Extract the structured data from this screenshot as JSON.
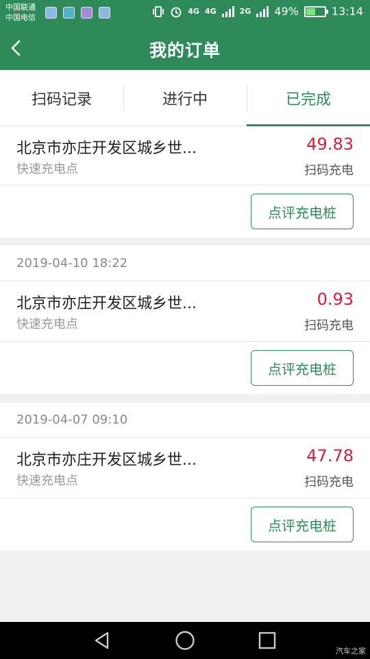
{
  "status_bar": {
    "carrier_1": "中国联通",
    "carrier_2": "中国电信",
    "network_1": "4G",
    "network_2": "4G",
    "network_3": "2G",
    "battery": "49%",
    "battery_level": 0.49,
    "time": "13:14"
  },
  "header": {
    "title": "我的订单"
  },
  "tabs": [
    {
      "label": "扫码记录",
      "active": false
    },
    {
      "label": "进行中",
      "active": false
    },
    {
      "label": "已完成",
      "active": true
    }
  ],
  "orders": [
    {
      "date": "",
      "station": "北京市亦庄开发区城乡世...",
      "type": "快速充电点",
      "amount": "49.83",
      "mode": "扫码充电",
      "action": "点评充电桩"
    },
    {
      "date": "2019-04-10 18:22",
      "station": "北京市亦庄开发区城乡世...",
      "type": "快速充电点",
      "amount": "0.93",
      "mode": "扫码充电",
      "action": "点评充电桩"
    },
    {
      "date": "2019-04-07 09:10",
      "station": "北京市亦庄开发区城乡世...",
      "type": "快速充电点",
      "amount": "47.78",
      "mode": "扫码充电",
      "action": "点评充电桩"
    }
  ],
  "watermark": "汽车之家",
  "colors": {
    "primary": "#2f8a5a",
    "amount": "#d21f3c"
  }
}
